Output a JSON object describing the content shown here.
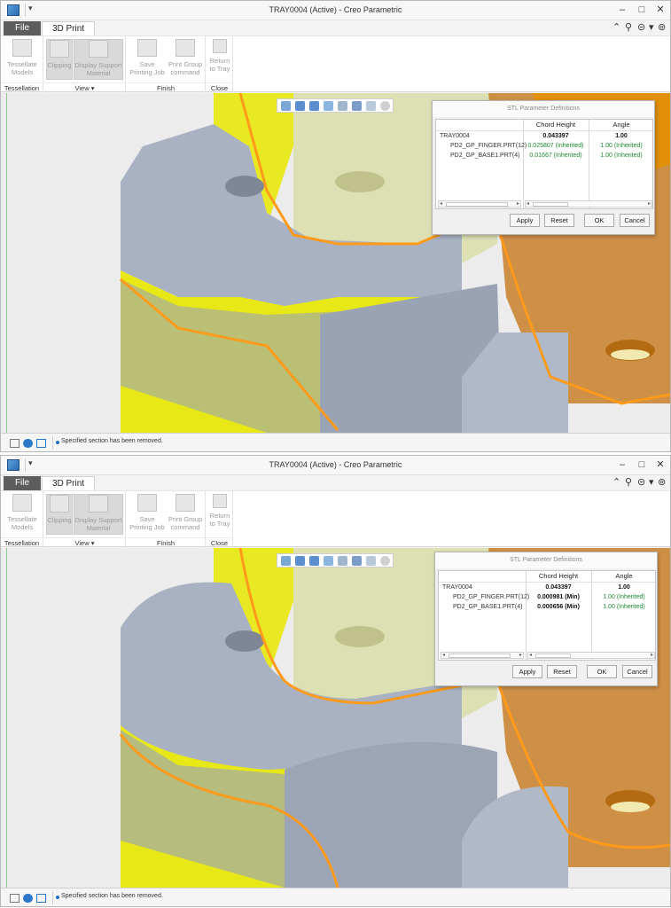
{
  "window": {
    "title": "TRAY0004 (Active) - Creo Parametric",
    "minimize_glyph": "–",
    "maximize_glyph": "□",
    "close_glyph": "✕"
  },
  "tabs": {
    "file": "File",
    "print3d": "3D Print"
  },
  "ribbon": {
    "tessellate": {
      "line1": "Tessellate",
      "line2": "Models",
      "icon": "tessellate-icon"
    },
    "clipping": {
      "line1": "Clipping",
      "icon": "clipping-icon"
    },
    "display_support": {
      "line1": "Display Support",
      "line2": "Material",
      "icon": "support-icon"
    },
    "save_job": {
      "line1": "Save",
      "line2": "Printing Job",
      "icon": "save-job-icon"
    },
    "print_group": {
      "line1": "Print Group",
      "line2": "command",
      "icon": "print-group-icon"
    },
    "return_tray": {
      "line1": "Return",
      "line2": "to Tray",
      "icon": "close-icon"
    },
    "groups": {
      "tessellation": "Tessellation",
      "view": "View ▾",
      "finish": "Finish",
      "close": "Close"
    }
  },
  "dialog": {
    "title": "STL Parameter Definitions",
    "columns": {
      "chord": "Chord Height",
      "angle": "Angle"
    },
    "buttons": {
      "apply": "Apply",
      "reset": "Reset",
      "ok": "OK",
      "cancel": "Cancel"
    }
  },
  "screens": [
    {
      "rows": [
        {
          "name": "TRAY0004",
          "chord": "0.043397",
          "angle": "1.00"
        },
        {
          "name": "PD2_GP_FINGER.PRT(12)",
          "chord": "0.025807 (Inherited)",
          "angle": "1.00 (Inherited)"
        },
        {
          "name": "PD2_GP_BASE1.PRT(4)",
          "chord": "0.01667 (Inherited)",
          "angle": "1.00 (Inherited)"
        }
      ],
      "status": "Specified section has been removed."
    },
    {
      "rows": [
        {
          "name": "TRAY0004",
          "chord": "0.043397",
          "angle": "1.00"
        },
        {
          "name": "PD2_GP_FINGER.PRT(12)",
          "chord": "0.000981 (Min)",
          "angle": "1.00 (Inherited)"
        },
        {
          "name": "PD2_GP_BASE1.PRT(4)",
          "chord": "0.000656 (Min)",
          "angle": "1.00 (Inherited)"
        }
      ],
      "status": "Specified section has been removed."
    }
  ],
  "colors": {
    "model_gray": "#a8b2c2",
    "model_yellow": "#e8e800",
    "model_orange": "#d98a00",
    "edge_orange": "#ff9a1a",
    "inherited_green": "#1d8a2e"
  }
}
